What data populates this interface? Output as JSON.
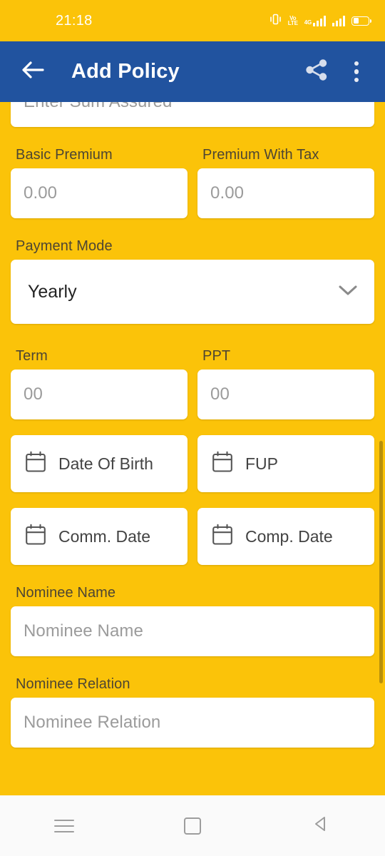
{
  "status_bar": {
    "time": "21:18",
    "icons": [
      "vibrate-icon",
      "volte-icon",
      "signal-4g-icon",
      "signal-icon",
      "battery-icon"
    ],
    "volte_top": "Vo",
    "volte_bottom": "LTE",
    "network_label": "4G"
  },
  "app_bar": {
    "title": "Add Policy",
    "back_icon": "back-arrow-icon",
    "share_icon": "share-icon",
    "overflow_icon": "more-vertical-icon",
    "background_color": "#21539F"
  },
  "theme": {
    "background_color": "#FBC309",
    "card_color": "#FFFFFF",
    "label_color": "#4D4533",
    "placeholder_color": "#9B9B9B",
    "scrollbar_color": "#B8900A"
  },
  "form": {
    "sum_assured": {
      "placeholder": "Enter Sum Assured",
      "value": ""
    },
    "basic_premium": {
      "label": "Basic Premium",
      "placeholder": "0.00",
      "value": ""
    },
    "premium_with_tax": {
      "label": "Premium With Tax",
      "placeholder": "0.00",
      "value": ""
    },
    "payment_mode": {
      "label": "Payment Mode",
      "selected": "Yearly",
      "chevron_icon": "chevron-down-icon"
    },
    "term": {
      "label": "Term",
      "placeholder": "00",
      "value": ""
    },
    "ppt": {
      "label": "PPT",
      "placeholder": "00",
      "value": ""
    },
    "date_of_birth": {
      "label": "Date Of Birth",
      "icon": "calendar-icon"
    },
    "fup": {
      "label": "FUP",
      "icon": "calendar-icon"
    },
    "comm_date": {
      "label": "Comm. Date",
      "icon": "calendar-icon"
    },
    "comp_date": {
      "label": "Comp. Date",
      "icon": "calendar-icon"
    },
    "nominee_name": {
      "label": "Nominee Name",
      "placeholder": "Nominee Name",
      "value": ""
    },
    "nominee_relation": {
      "label": "Nominee Relation",
      "placeholder": "Nominee Relation",
      "value": ""
    }
  },
  "nav_bar": {
    "recents_icon": "menu-icon",
    "home_icon": "home-square-icon",
    "back_icon": "back-triangle-icon"
  }
}
